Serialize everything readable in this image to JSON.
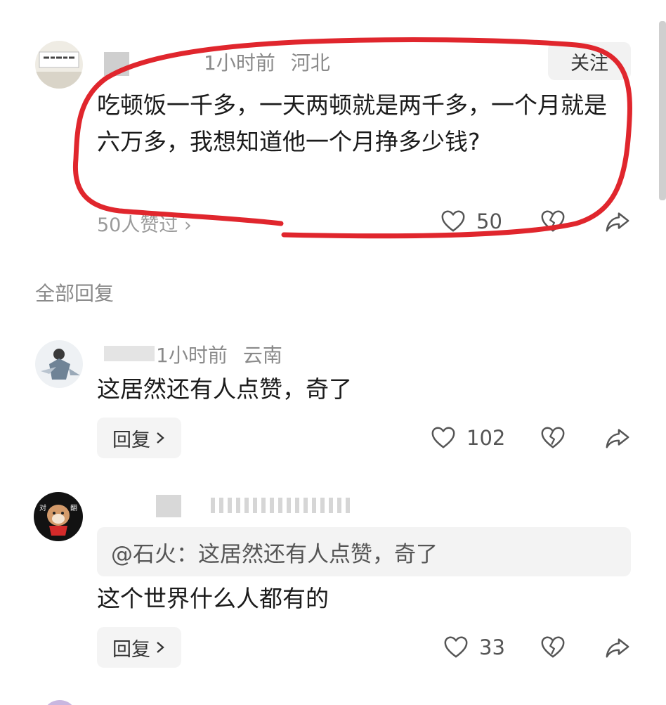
{
  "main_comment": {
    "time": "1小时前",
    "location": "河北",
    "follow_label": "关注",
    "text": "吃顿饭一千多，一天两顿就是两千多，一个月就是六万多，我想知道他一个月挣多少钱?",
    "likes_link": "50人赞过 ›",
    "like_count": "50"
  },
  "replies_header": "全部回复",
  "replies": [
    {
      "time": "1小时前",
      "location": "云南",
      "text": "这居然还有人点赞，奇了",
      "reply_label": "回复",
      "like_count": "102"
    },
    {
      "quote": "@石火：这居然还有人点赞，奇了",
      "text": "这个世界什么人都有的",
      "reply_label": "回复",
      "like_count": "33"
    }
  ],
  "colors": {
    "annotation_red": "#e0262d",
    "meta_gray": "#8a8a8a",
    "button_bg": "#f4f4f4"
  },
  "icons": [
    "heart-icon",
    "dislike-heart-icon",
    "share-icon",
    "chevron-right-icon"
  ]
}
